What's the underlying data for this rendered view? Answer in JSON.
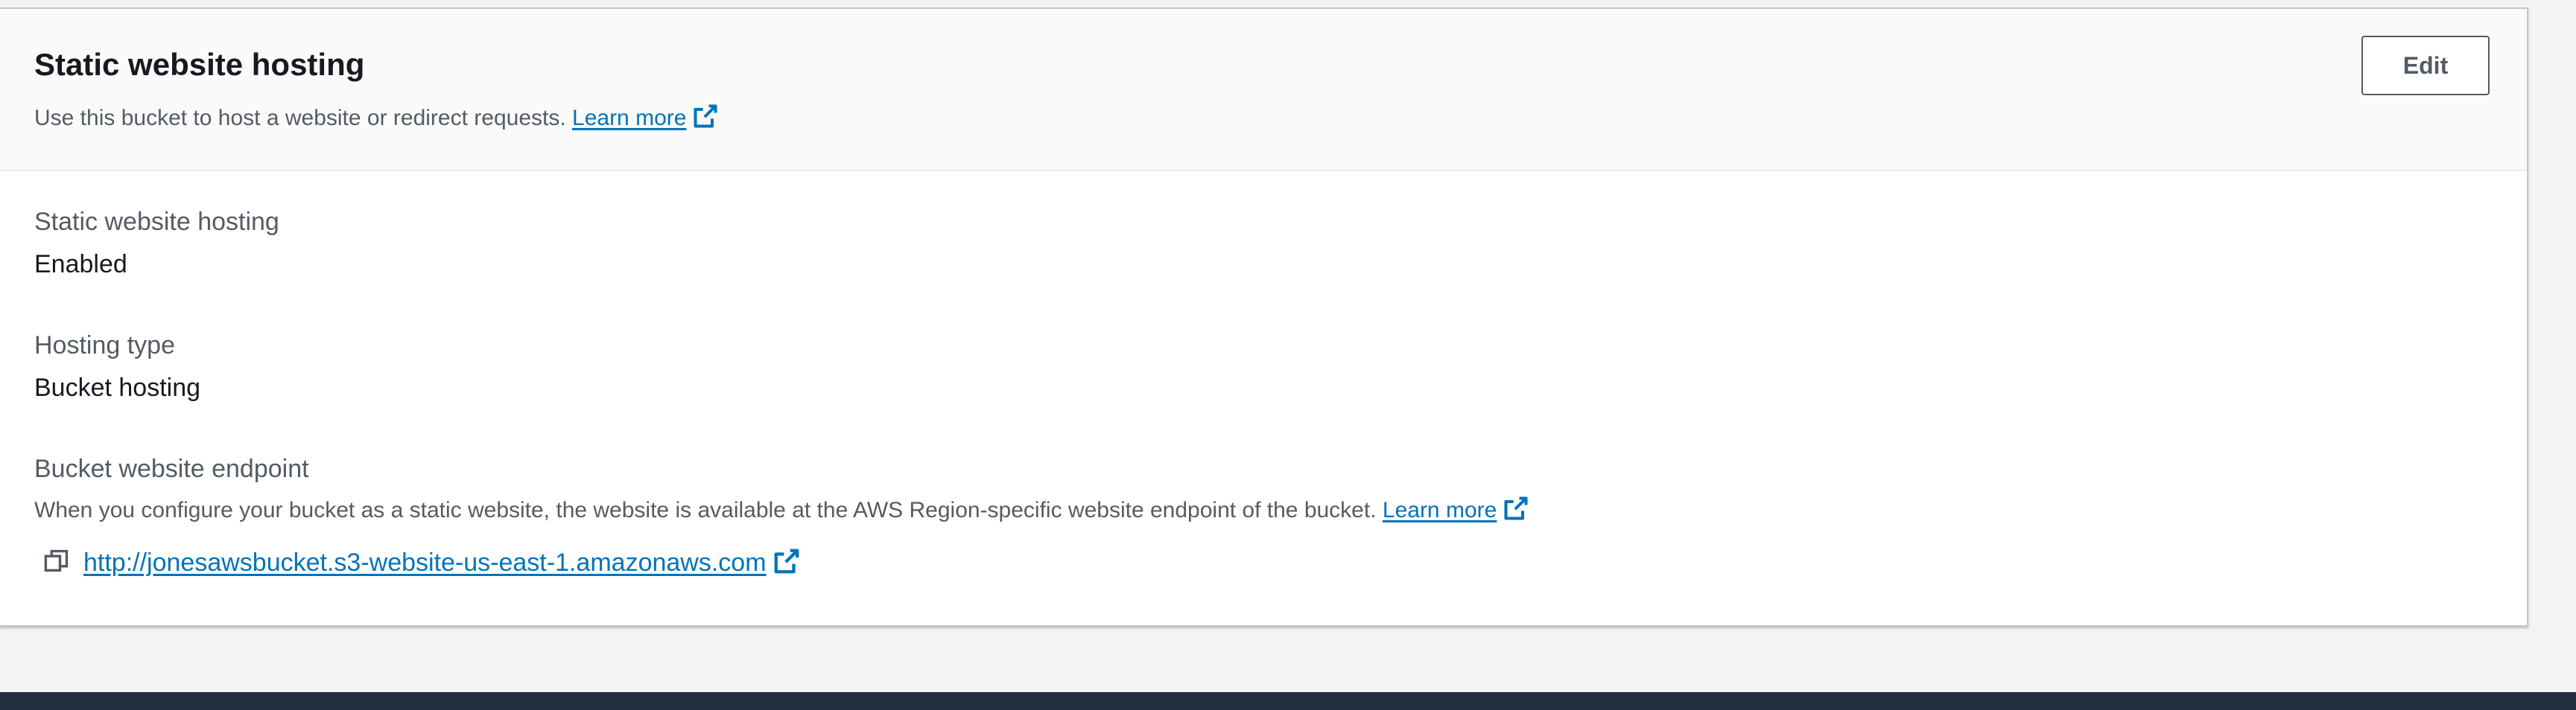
{
  "panel": {
    "title": "Static website hosting",
    "description": "Use this bucket to host a website or redirect requests.",
    "learn_more_label": "Learn more",
    "edit_label": "Edit"
  },
  "fields": {
    "hosting": {
      "label": "Static website hosting",
      "value": "Enabled"
    },
    "hosting_type": {
      "label": "Hosting type",
      "value": "Bucket hosting"
    },
    "endpoint": {
      "label": "Bucket website endpoint",
      "description": "When you configure your bucket as a static website, the website is available at the AWS Region-specific website endpoint of the bucket.",
      "learn_more_label": "Learn more",
      "url": "http://jonesawsbucket.s3-website-us-east-1.amazonaws.com"
    }
  },
  "icons": {
    "external_link": "external-link-icon",
    "copy": "copy-icon"
  },
  "colors": {
    "link": "#0073bb",
    "footer": "#232f3e",
    "page_background": "#f2f3f3"
  }
}
